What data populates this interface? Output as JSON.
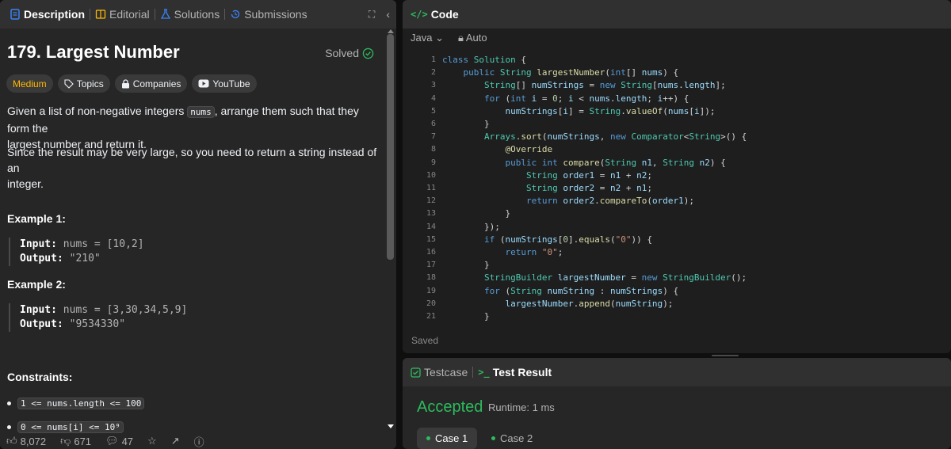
{
  "left_tabs": {
    "description": "Description",
    "editorial": "Editorial",
    "solutions": "Solutions",
    "submissions": "Submissions"
  },
  "problem": {
    "title": "179. Largest Number",
    "solved_label": "Solved",
    "difficulty": "Medium",
    "topics": "Topics",
    "companies": "Companies",
    "youtube": "YouTube",
    "desc1_pre": "Given a list of non-negative integers",
    "desc1_code": "nums",
    "desc1_post": ", arrange them such that they form the",
    "desc1_line2": "largest number and return it.",
    "desc2_line1": "Since the result may be very large, so you need to return a string instead of an",
    "desc2_line2": "integer."
  },
  "examples": [
    {
      "title": "Example 1:",
      "input_label": "Input:",
      "input_value": "nums = [10,2]",
      "output_label": "Output:",
      "output_value": "\"210\""
    },
    {
      "title": "Example 2:",
      "input_label": "Input:",
      "input_value": "nums = [3,30,34,5,9]",
      "output_label": "Output:",
      "output_value": "\"9534330\""
    }
  ],
  "constraints": {
    "title": "Constraints:",
    "c1": "1 <= nums.length <= 100",
    "c2": "0 <= nums[i] <= 10⁹"
  },
  "footer": {
    "likes": "8,072",
    "dislikes": "671",
    "comments": "47"
  },
  "code_panel": {
    "title": "Code",
    "language": "Java",
    "mode": "Auto",
    "saved": "Saved",
    "line_numbers": [
      "1",
      "2",
      "3",
      "4",
      "5",
      "6",
      "7",
      "8",
      "9",
      "10",
      "11",
      "12",
      "13",
      "14",
      "15",
      "16",
      "17",
      "18",
      "19",
      "20",
      "21"
    ]
  },
  "result_panel": {
    "testcase_tab": "Testcase",
    "result_tab": "Test Result",
    "status": "Accepted",
    "runtime": "Runtime: 1 ms",
    "case1": "Case 1",
    "case2": "Case 2"
  },
  "colors": {
    "accent_green": "#2cbb5d",
    "medium": "#ffb800"
  }
}
